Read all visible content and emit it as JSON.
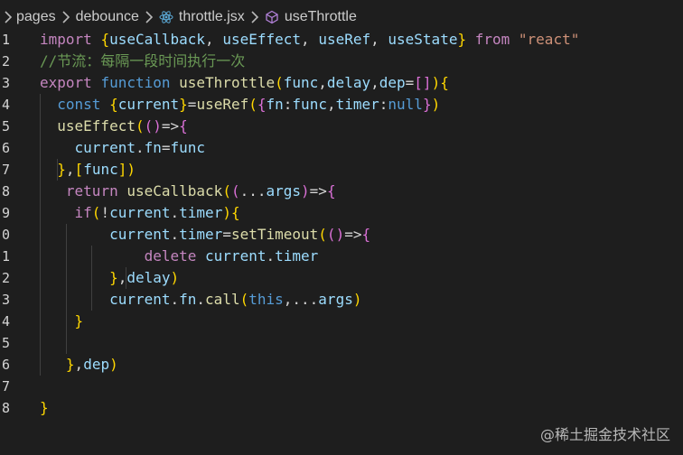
{
  "breadcrumb": {
    "items": [
      {
        "label": "pages",
        "icon": "chevron-right-icon"
      },
      {
        "label": "debounce",
        "icon": "chevron-right-icon"
      },
      {
        "label": "throttle.jsx",
        "icon": "react-file-icon"
      },
      {
        "label": "useThrottle",
        "icon": "function-symbol-icon"
      }
    ]
  },
  "editor": {
    "language": "javascript",
    "lines": [
      {
        "number": "1",
        "code": "import {useCallback, useEffect, useRef, useState} from \"react\""
      },
      {
        "number": "2",
        "code": "//节流：每隔一段时间执行一次"
      },
      {
        "number": "3",
        "code": "export function useThrottle(func,delay,dep=[]){"
      },
      {
        "number": "4",
        "code": "  const {current}=useRef({fn:func,timer:null})"
      },
      {
        "number": "5",
        "code": "  useEffect(()=>{"
      },
      {
        "number": "6",
        "code": "    current.fn=func"
      },
      {
        "number": "7",
        "code": "  },[func])"
      },
      {
        "number": "8",
        "code": "   return useCallback((...args)=>{"
      },
      {
        "number": "9",
        "code": "    if(!current.timer){"
      },
      {
        "number": "0",
        "code": "        current.timer=setTimeout(()=>{"
      },
      {
        "number": "1",
        "code": "            delete current.timer"
      },
      {
        "number": "2",
        "code": "        },delay)"
      },
      {
        "number": "3",
        "code": "        current.fn.call(this,...args)"
      },
      {
        "number": "4",
        "code": "    }"
      },
      {
        "number": "5",
        "code": ""
      },
      {
        "number": "6",
        "code": "   },dep)"
      },
      {
        "number": "7",
        "code": ""
      },
      {
        "number": "8",
        "code": "}"
      }
    ]
  },
  "watermark": "@稀土掘金技术社区",
  "colors": {
    "background": "#1e1e1e",
    "keyword": "#569cd6",
    "control_keyword": "#c586c0",
    "function": "#dcdcaa",
    "variable": "#9cdcfe",
    "string": "#ce9178",
    "comment": "#6a9955",
    "brace_level_1": "#ffd700",
    "brace_level_2": "#da70d6",
    "brace_level_3": "#179fff"
  }
}
